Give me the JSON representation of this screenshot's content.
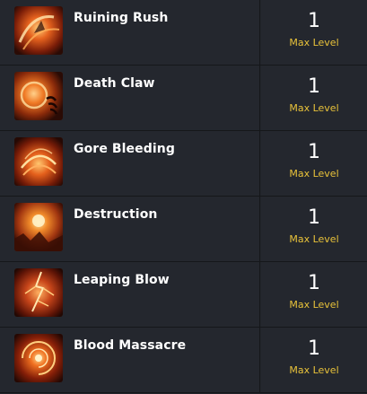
{
  "skills": [
    {
      "name": "Ruining Rush",
      "level": "1",
      "level_label": "Max Level",
      "icon": "ruining-rush-icon"
    },
    {
      "name": "Death Claw",
      "level": "1",
      "level_label": "Max Level",
      "icon": "death-claw-icon"
    },
    {
      "name": "Gore Bleeding",
      "level": "1",
      "level_label": "Max Level",
      "icon": "gore-bleeding-icon"
    },
    {
      "name": "Destruction",
      "level": "1",
      "level_label": "Max Level",
      "icon": "destruction-icon"
    },
    {
      "name": "Leaping Blow",
      "level": "1",
      "level_label": "Max Level",
      "icon": "leaping-blow-icon"
    },
    {
      "name": "Blood Massacre",
      "level": "1",
      "level_label": "Max Level",
      "icon": "blood-massacre-icon"
    }
  ],
  "colors": {
    "background": "#24272e",
    "divider": "#15171a",
    "name_text": "#ffffff",
    "level_label": "#e8c23a",
    "icon_fire_light": "#ffcf7a",
    "icon_fire": "#e5621e",
    "icon_dark": "#2a0b05"
  }
}
